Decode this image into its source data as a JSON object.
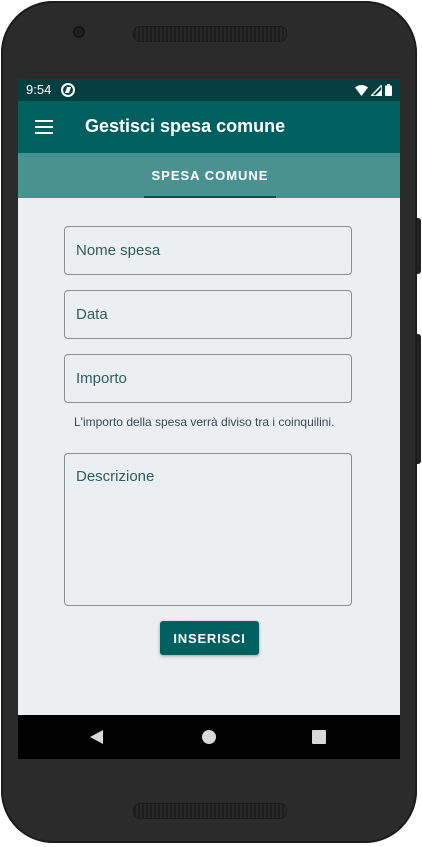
{
  "status_bar": {
    "time": "9:54"
  },
  "app_bar": {
    "title": "Gestisci spesa comune"
  },
  "tabs": [
    {
      "label": "SPESA COMUNE",
      "selected": true
    }
  ],
  "form": {
    "name_placeholder": "Nome spesa",
    "date_placeholder": "Data",
    "amount_placeholder": "Importo",
    "amount_helper": "L'importo della spesa verrà diviso tra i coinquilini.",
    "description_placeholder": "Descrizione",
    "submit_label": "INSERISCI"
  },
  "icons": {
    "menu": "menu-icon",
    "sync": "sync-icon",
    "wifi": "wifi-icon",
    "signal": "signal-icon",
    "battery": "battery-icon",
    "back": "back-icon",
    "home": "home-icon",
    "recent": "recent-apps-icon"
  },
  "colors": {
    "status_bar": "#053f3f",
    "app_bar": "#005f5f",
    "tab_bar": "#4a9292",
    "background": "#eceff1",
    "accent": "#005f5f",
    "field_text": "#2f5d5d"
  }
}
